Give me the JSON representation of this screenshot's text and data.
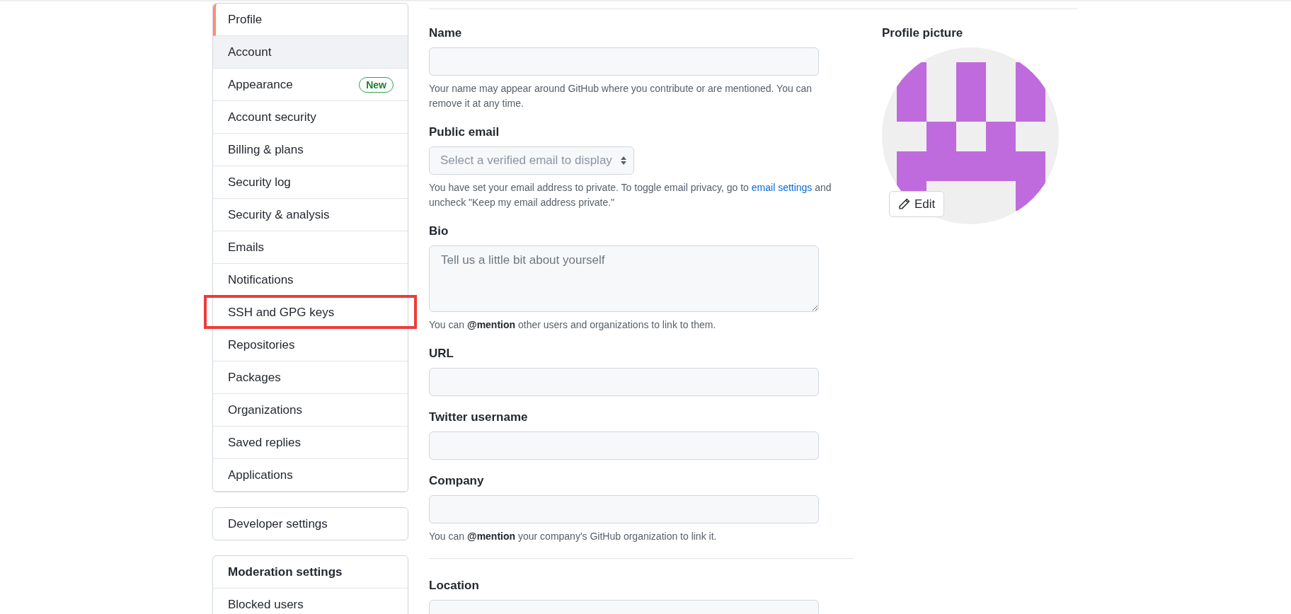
{
  "sidebar": {
    "items": [
      {
        "label": "Profile",
        "selected": true,
        "hovered": false,
        "highlighted": false
      },
      {
        "label": "Account",
        "selected": false,
        "hovered": true,
        "highlighted": false
      },
      {
        "label": "Appearance",
        "selected": false,
        "hovered": false,
        "highlighted": false,
        "badge": "New"
      },
      {
        "label": "Account security",
        "selected": false,
        "hovered": false,
        "highlighted": false
      },
      {
        "label": "Billing & plans",
        "selected": false,
        "hovered": false,
        "highlighted": false
      },
      {
        "label": "Security log",
        "selected": false,
        "hovered": false,
        "highlighted": false
      },
      {
        "label": "Security & analysis",
        "selected": false,
        "hovered": false,
        "highlighted": false
      },
      {
        "label": "Emails",
        "selected": false,
        "hovered": false,
        "highlighted": false
      },
      {
        "label": "Notifications",
        "selected": false,
        "hovered": false,
        "highlighted": false
      },
      {
        "label": "SSH and GPG keys",
        "selected": false,
        "hovered": false,
        "highlighted": true
      },
      {
        "label": "Repositories",
        "selected": false,
        "hovered": false,
        "highlighted": false
      },
      {
        "label": "Packages",
        "selected": false,
        "hovered": false,
        "highlighted": false
      },
      {
        "label": "Organizations",
        "selected": false,
        "hovered": false,
        "highlighted": false
      },
      {
        "label": "Saved replies",
        "selected": false,
        "hovered": false,
        "highlighted": false
      },
      {
        "label": "Applications",
        "selected": false,
        "hovered": false,
        "highlighted": false
      }
    ],
    "developer_settings": "Developer settings",
    "moderation": {
      "title": "Moderation settings",
      "items": [
        "Blocked users"
      ]
    }
  },
  "form": {
    "fields": [
      {
        "kind": "text",
        "label": "Name",
        "help": "Your name may appear around GitHub where you contribute or are mentioned. You can remove it at any time."
      },
      {
        "kind": "select",
        "label": "Public email",
        "placeholder": "Select a verified email to display",
        "help": "You have set your email address to private. To toggle email privacy, go to",
        "help_link": "email settings",
        "help_after": "and uncheck \"Keep my email address private.\""
      },
      {
        "kind": "textarea",
        "label": "Bio",
        "placeholder": "Tell us a little bit about yourself",
        "help": "You can **@mention** other users and organizations to link to them."
      },
      {
        "kind": "text",
        "label": "URL"
      },
      {
        "kind": "text",
        "label": "Twitter username"
      },
      {
        "kind": "text",
        "label": "Company",
        "help": "You can **@mention** your company's GitHub organization to link it."
      },
      {
        "kind": "text",
        "label": "Location",
        "divider_before": true
      }
    ]
  },
  "profile_picture": {
    "title": "Profile picture",
    "edit_button": "Edit"
  }
}
